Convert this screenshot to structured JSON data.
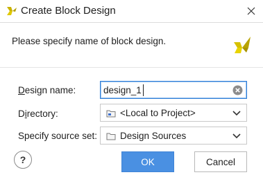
{
  "window": {
    "title": "Create Block Design",
    "app_icon": "vivado-icon",
    "close_icon": "close-icon"
  },
  "header": {
    "prompt": "Please specify name of block design.",
    "logo": "vivado-logo"
  },
  "form": {
    "design_name": {
      "label_mnemonic": "D",
      "label_rest": "esign name:",
      "value": "design_1",
      "clear_icon": "clear-icon"
    },
    "directory": {
      "label_first": "D",
      "label_mnemonic": "i",
      "label_rest": "rectory:",
      "value": "<Local to Project>",
      "icon": "folder-local-icon",
      "dropdown_icon": "chevron-down-icon"
    },
    "source_set": {
      "label": "Specify source set:",
      "value": "Design Sources",
      "icon": "folder-icon",
      "dropdown_icon": "chevron-down-icon"
    }
  },
  "buttons": {
    "help": "?",
    "ok": "OK",
    "cancel": "Cancel"
  },
  "colors": {
    "accent": "#4a90e2",
    "focus_border": "#2f7fd8",
    "logo": "#c8b400"
  }
}
